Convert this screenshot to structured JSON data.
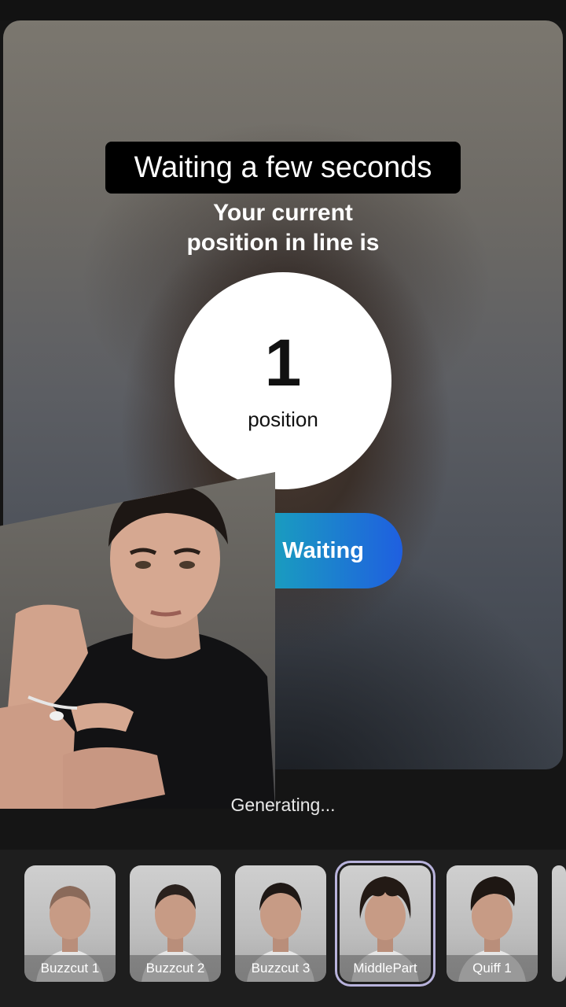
{
  "caption": "Waiting a few seconds",
  "queue": {
    "line1": "Your current",
    "line2": "position in line is",
    "position_number": "1",
    "position_unit": "position"
  },
  "skip_button": "Skip Waiting",
  "status": "Generating...",
  "styles": [
    {
      "label": "Buzzcut 1",
      "hair": "buzz"
    },
    {
      "label": "Buzzcut 2",
      "hair": "buzz-dark"
    },
    {
      "label": "Buzzcut 3",
      "hair": "buzz-dark"
    },
    {
      "label": "MiddlePart",
      "hair": "curly",
      "selected": true
    },
    {
      "label": "Quiff 1",
      "hair": "quiff"
    }
  ],
  "colors": {
    "button_gradient_start": "#19b98a",
    "button_gradient_end": "#1f5fe0",
    "selected_outline": "#b8b3dc"
  }
}
